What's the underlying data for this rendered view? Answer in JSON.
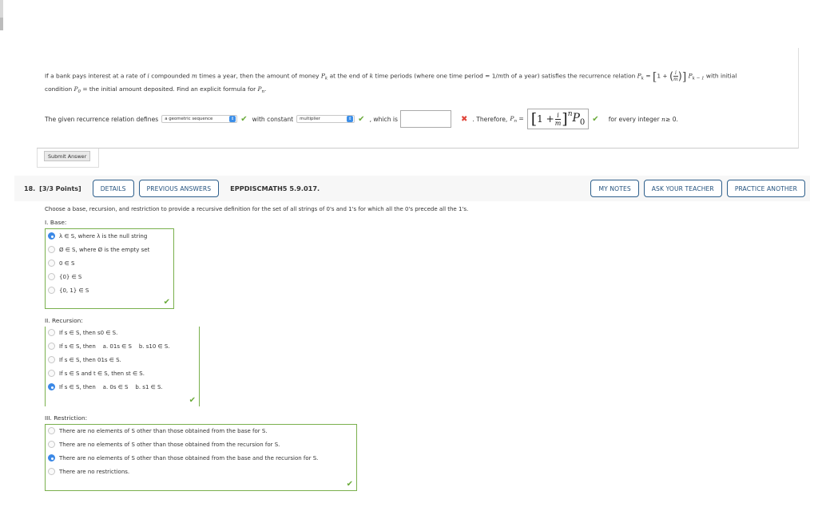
{
  "previous_problem": {
    "line1_prefix": "If a bank pays interest at a rate of ",
    "var_i": "i",
    "line1_mid1": " compounded ",
    "var_m": "m",
    "line1_mid2": " times a year, then the amount of money ",
    "var_P": "P",
    "sub_k": "k",
    "line1_mid3": " at the end of ",
    "var_k": "k",
    "line1_mid4": " time periods (where one time period = 1/",
    "line1_mid5": "th of a year) satisfies the recurrence relation ",
    "eq": " = ",
    "one_plus": "1 + ",
    "sub_k_minus_1": "k − 1",
    "line1_suffix": " with initial",
    "line2_prefix": "condition ",
    "sub_0": "0",
    "line2_mid": " = the initial amount deposited. Find an explicit formula for ",
    "sub_n": "n",
    "line2_suffix": ".",
    "answer_prefix": "The given recurrence relation defines",
    "select_sequence": "a geometric sequence",
    "answer_mid1": "with constant",
    "select_constant": "multiplier",
    "answer_mid2": ", which is",
    "blank_value": "",
    "answer_mid3": ". Therefore,",
    "formula": {
      "one": "1 +",
      "num": "i",
      "den": "m",
      "exp": "n",
      "P": "P",
      "sub": "0"
    },
    "answer_suffix": "for every integer",
    "answer_suffix_var": "n",
    "answer_suffix_end": " ≥ 0.",
    "submit_label": "Submit Answer"
  },
  "question": {
    "number": "18.",
    "points": "[3/3 Points]",
    "details_label": "DETAILS",
    "previous_answers_label": "PREVIOUS ANSWERS",
    "code": "EPPDISCMATH5 5.9.017.",
    "my_notes_label": "MY NOTES",
    "ask_teacher_label": "ASK YOUR TEACHER",
    "practice_another_label": "PRACTICE ANOTHER",
    "instructions": "Choose a base, recursion, and restriction to provide a recursive definition for the set of all strings of 0's and 1's for which all the 0's precede all the 1's.",
    "base": {
      "title": "I. Base:",
      "options": [
        {
          "label": "λ ∈ S, where λ is the null string",
          "selected": true
        },
        {
          "label": "Ø ∈ S, where Ø is the empty set",
          "selected": false
        },
        {
          "label": "0 ∈ S",
          "selected": false
        },
        {
          "label": "{0} ∈ S",
          "selected": false
        },
        {
          "label": "{0, 1} ∈ S",
          "selected": false
        }
      ]
    },
    "recursion": {
      "title": "II. Recursion:",
      "options": [
        {
          "label": "If s ∈ S, then s0 ∈ S.",
          "selected": false
        },
        {
          "label": "If s ∈ S, then    a. 01s ∈ S    b. s10 ∈ S.",
          "selected": false
        },
        {
          "label": "If s ∈ S, then 01s ∈ S.",
          "selected": false
        },
        {
          "label": "If s ∈ S and t ∈ S, then st ∈ S.",
          "selected": false
        },
        {
          "label": "If s ∈ S, then    a. 0s ∈ S    b. s1 ∈ S.",
          "selected": true
        }
      ]
    },
    "restriction": {
      "title": "III. Restriction:",
      "options": [
        {
          "label": "There are no elements of S other than those obtained from the base for S.",
          "selected": false
        },
        {
          "label": "There are no elements of S other than those obtained from the recursion for S.",
          "selected": false
        },
        {
          "label": "There are no elements of S other than those obtained from the base and the recursion for S.",
          "selected": true
        },
        {
          "label": "There are no restrictions.",
          "selected": false
        }
      ]
    }
  },
  "icons": {
    "check": "✔",
    "cross": "✖",
    "select_arrows": "⇕"
  },
  "colors": {
    "accent_blue": "#3b88e6",
    "correct_green": "#6aaa3a",
    "incorrect_red": "#e0453a",
    "button_border": "#2e5f8c"
  }
}
